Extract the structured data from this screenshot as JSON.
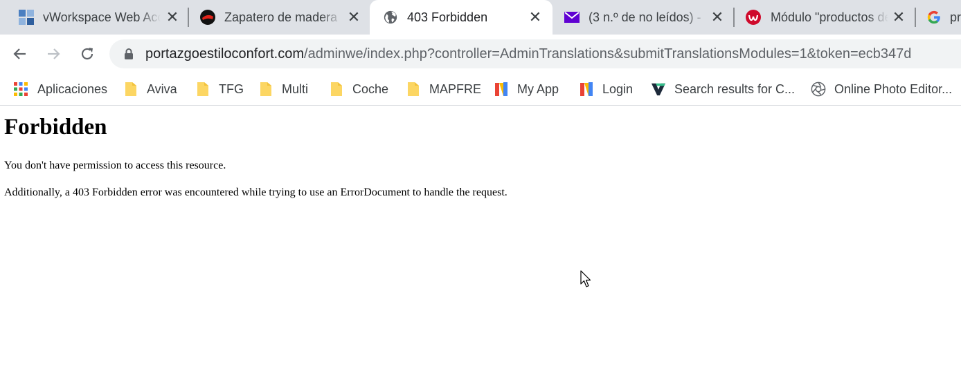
{
  "tabs": [
    {
      "title": "vWorkspace Web Access",
      "icon": "vworkspace-icon"
    },
    {
      "title": "Zapatero de madera",
      "icon": "shop-logo-icon"
    },
    {
      "title": "403 Forbidden",
      "icon": "globe-icon",
      "active": true
    },
    {
      "title": "(3 n.º de no leídos) -",
      "icon": "mail-icon"
    },
    {
      "title": "Módulo \"productos de",
      "icon": "webkul-icon"
    },
    {
      "title": "pr",
      "icon": "google-icon"
    }
  ],
  "omnibox": {
    "host": "portazgoestiloconfort.com",
    "path": "/adminwe/index.php?controller=AdminTranslations&submitTranslationsModules=1&token=ecb347d"
  },
  "bookmarks": [
    {
      "label": "Aplicaciones",
      "icon": "apps-grid-icon"
    },
    {
      "label": "Aviva",
      "icon": "folder-icon"
    },
    {
      "label": "TFG",
      "icon": "folder-icon"
    },
    {
      "label": "Multi",
      "icon": "folder-icon"
    },
    {
      "label": "Coche",
      "icon": "folder-icon"
    },
    {
      "label": "MAPFRE",
      "icon": "folder-icon"
    },
    {
      "label": "My App",
      "icon": "n-logo-icon"
    },
    {
      "label": "Login",
      "icon": "n-logo-icon"
    },
    {
      "label": "Search results for C...",
      "icon": "v-logo-icon"
    },
    {
      "label": "Online Photo Editor...",
      "icon": "aperture-icon"
    }
  ],
  "page": {
    "heading": "Forbidden",
    "message": "You don't have permission to access this resource.",
    "additional": "Additionally, a 403 Forbidden error was encountered while trying to use an ErrorDocument to handle the request."
  },
  "colors": {
    "tabstrip_bg": "#dee1e6",
    "omnibox_bg": "#f1f3f4",
    "folder_yellow": "#fcd663",
    "mail_purple": "#6001d2",
    "webkul_red": "#cf0a2c"
  }
}
